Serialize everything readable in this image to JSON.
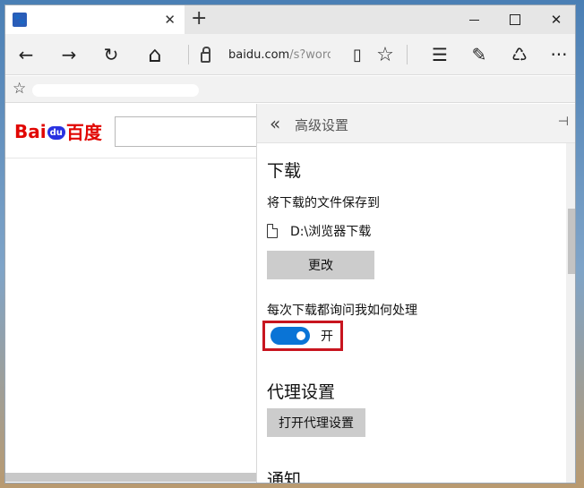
{
  "window": {
    "tab_favicon": "🐾",
    "tab_close": "✕",
    "new_tab": "+",
    "window_controls": {
      "close": "✕"
    }
  },
  "navbar": {
    "back": "←",
    "forward": "→",
    "refresh": "↻",
    "home": "⌂",
    "url_host": "baidu.com",
    "url_rest": "/s?word=",
    "reading_view": "▯",
    "favorite": "☆",
    "hub": "☰",
    "note": "✎",
    "share": "♺",
    "more": "···"
  },
  "favbar": {
    "star": "☆"
  },
  "page": {
    "logo_bai": "Bai",
    "logo_du": "du",
    "logo_cn": "百度"
  },
  "panel": {
    "back_icon": "«",
    "title": "高级设置",
    "pin_icon": "⊣",
    "download_section": "下载",
    "save_location_label": "将下载的文件保存到",
    "download_path": "D:\\浏览器下载",
    "change_button": "更改",
    "ask_label": "每次下载都询问我如何处理",
    "toggle_state": "开",
    "proxy_section": "代理设置",
    "proxy_button": "打开代理设置",
    "notify_section": "通知"
  },
  "colors": {
    "accent": "#0a74d6",
    "highlight_border": "#c8151f",
    "baidu_red": "#e10602",
    "baidu_blue": "#2932e1"
  }
}
